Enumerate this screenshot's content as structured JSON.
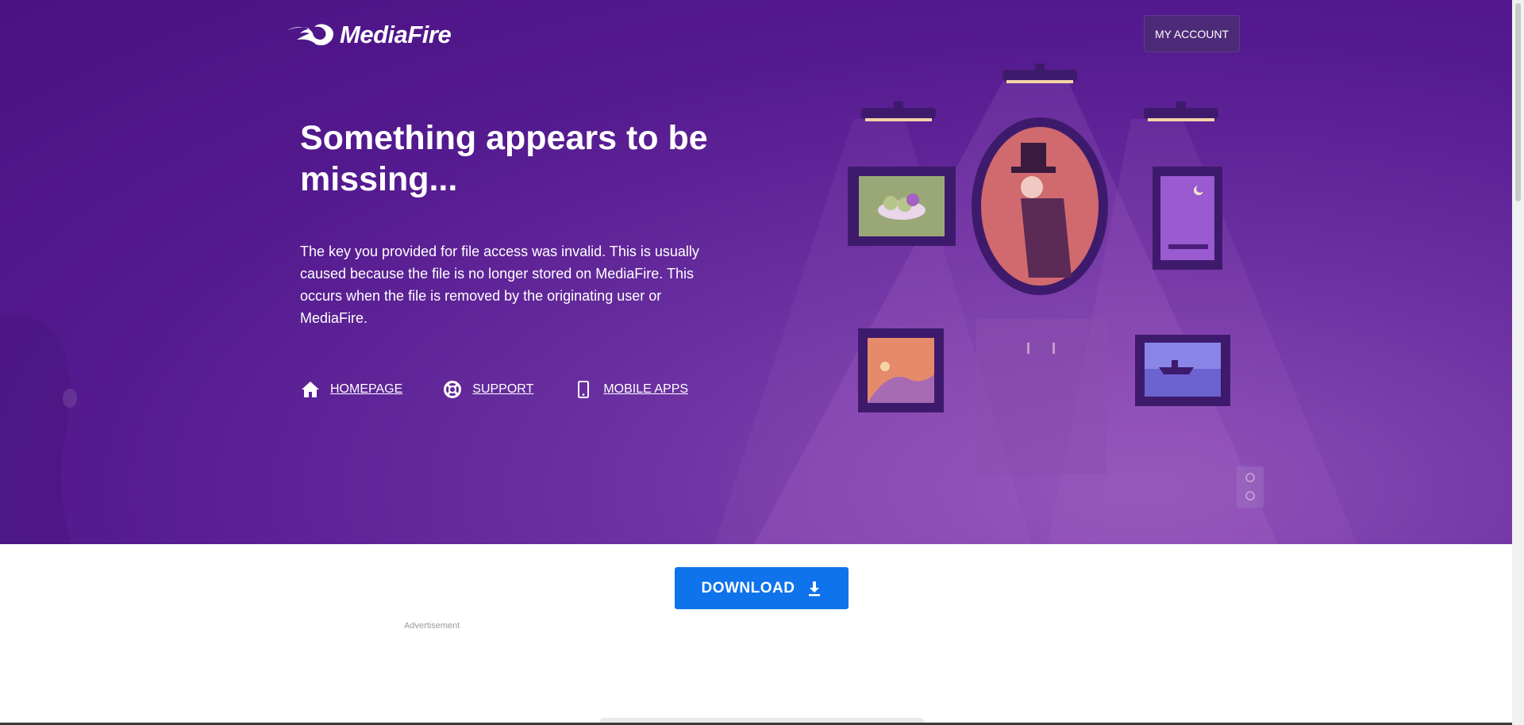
{
  "header": {
    "logo_text": "MediaFire",
    "account_label": "MY ACCOUNT"
  },
  "error": {
    "title": "Something appears to be missing...",
    "description": "The key you provided for file access was invalid. This is usually caused because the file is no longer stored on MediaFire. This occurs when the file is removed by the originating user or MediaFire."
  },
  "links": [
    {
      "label": "HOMEPAGE",
      "icon": "home-icon"
    },
    {
      "label": "SUPPORT",
      "icon": "lifebuoy-icon"
    },
    {
      "label": "MOBILE APPS",
      "icon": "phone-icon"
    }
  ],
  "download": {
    "label": "DOWNLOAD",
    "icon": "download-icon"
  },
  "ad": {
    "label": "Advertisement"
  },
  "colors": {
    "hero_purple": "#541a8f",
    "download_blue": "#0f73ec",
    "account_button": "#4d2a78"
  }
}
